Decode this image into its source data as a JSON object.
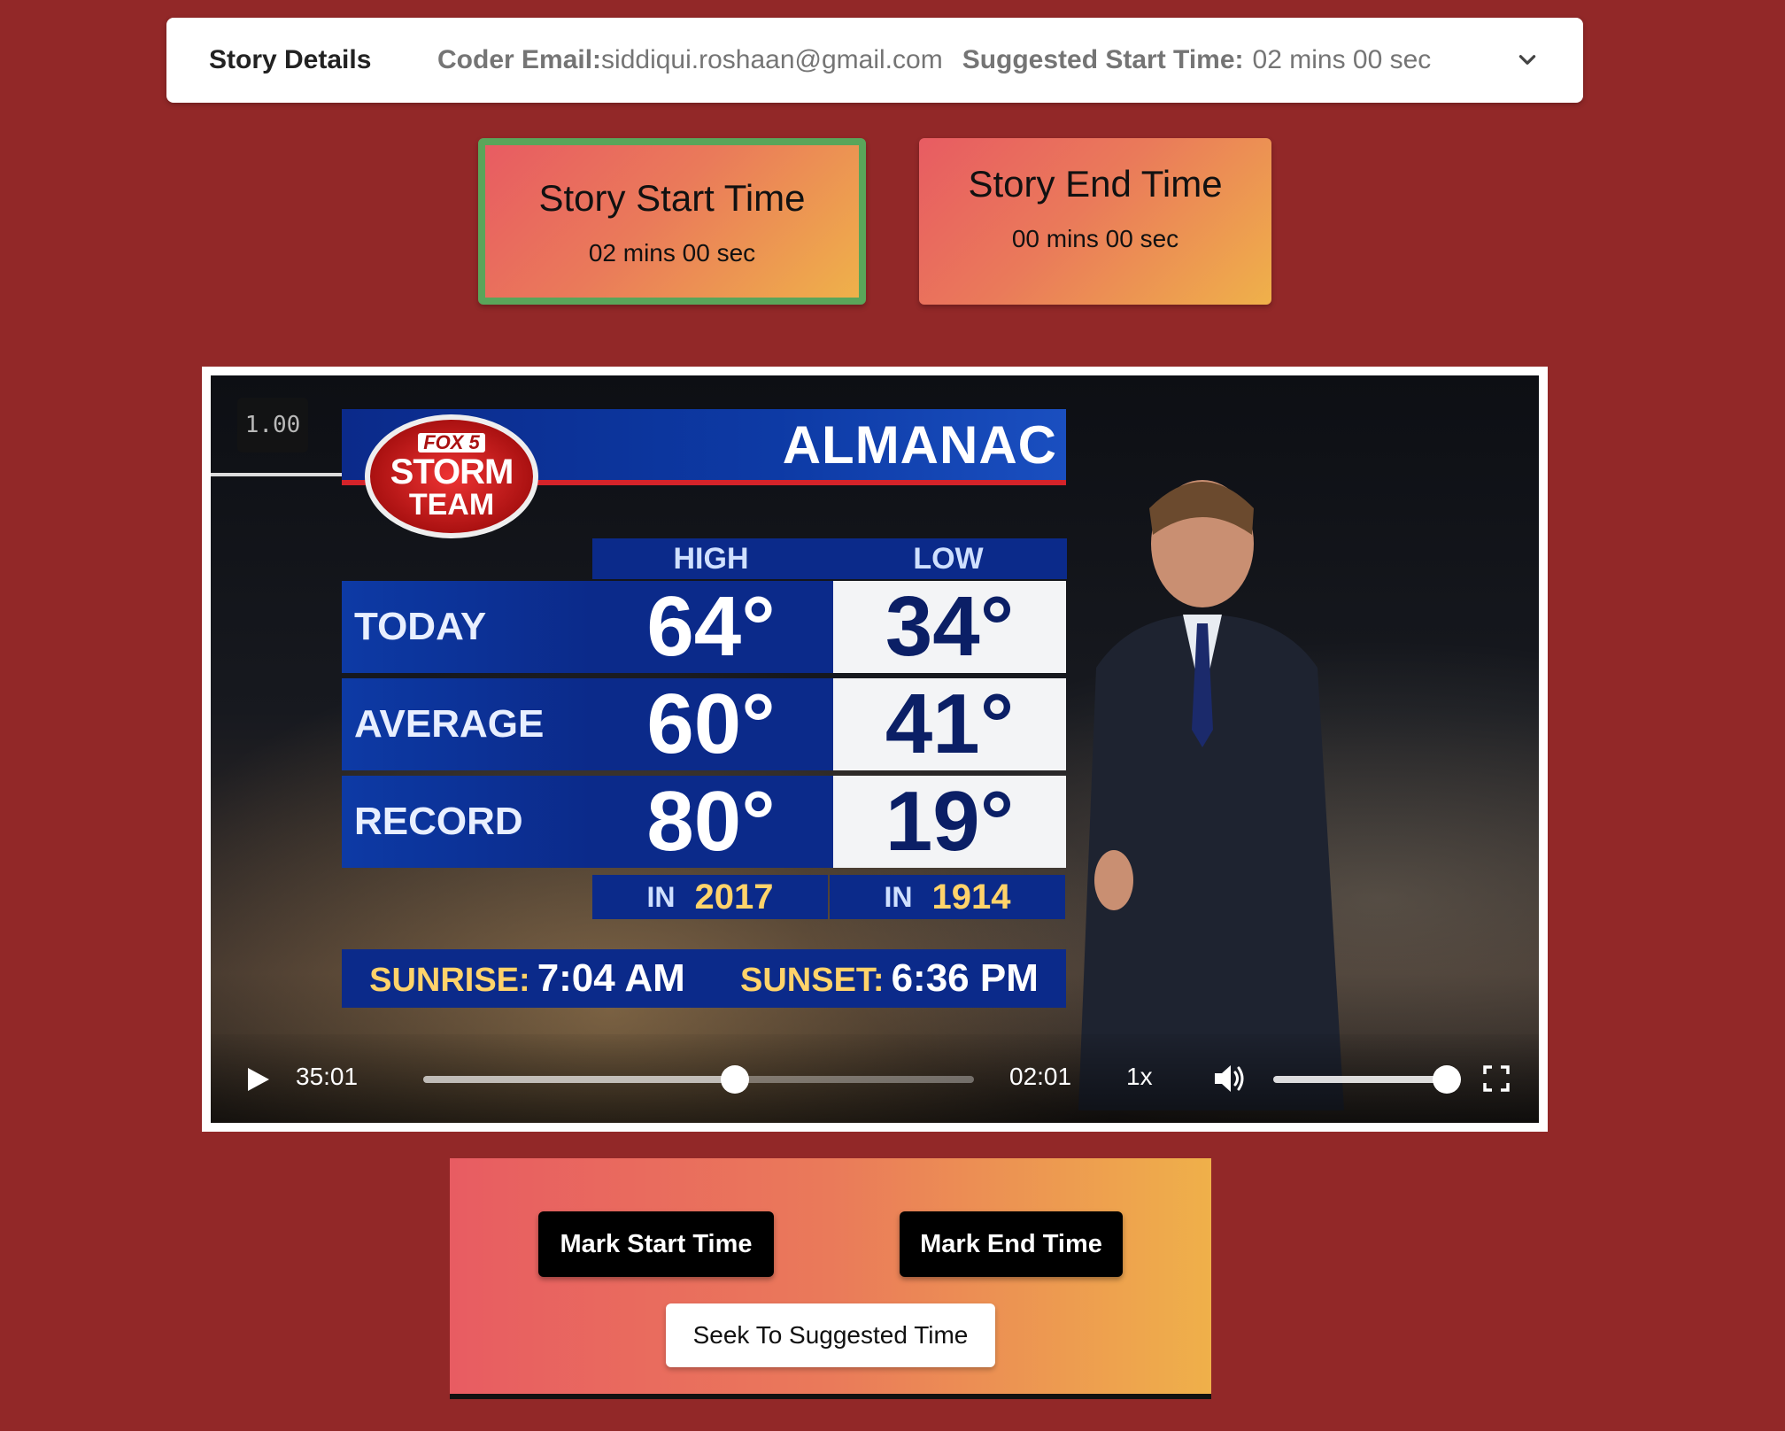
{
  "details": {
    "title": "Story Details",
    "coder_email_label": "Coder Email:",
    "coder_email": "siddiqui.roshaan@gmail.com",
    "suggested_start_label": "Suggested Start Time:",
    "suggested_start_value": "02 mins 00 sec",
    "expand_icon": "chevron-down-icon"
  },
  "cards": {
    "start": {
      "title": "Story Start Time",
      "time": "02 mins 00 sec",
      "highlight_color": "#5aa55a"
    },
    "end": {
      "title": "Story End Time",
      "time": "00 mins 00 sec"
    }
  },
  "video": {
    "speed_badge": "1.00",
    "frame": {
      "header": "ALMANAC",
      "logo": {
        "brand": "FOX 5",
        "line1": "STORM",
        "line2": "TEAM"
      },
      "columns": [
        "HIGH",
        "LOW"
      ],
      "rows": [
        {
          "label": "TODAY",
          "high": "64°",
          "low": "34°"
        },
        {
          "label": "AVERAGE",
          "high": "60°",
          "low": "41°"
        },
        {
          "label": "RECORD",
          "high": "80°",
          "low": "19°"
        }
      ],
      "record_years": [
        {
          "in": "IN",
          "year": "2017"
        },
        {
          "in": "IN",
          "year": "1914"
        }
      ],
      "sunrise_label": "SUNRISE:",
      "sunrise": "7:04 AM",
      "sunset_label": "SUNSET:",
      "sunset": "6:36 PM"
    },
    "controls": {
      "duration": "35:01",
      "current_time": "02:01",
      "playback_speed": "1x",
      "progress_fraction": 0.566,
      "volume_fraction": 1.0,
      "icons": [
        "play-icon",
        "volume-icon",
        "fullscreen-icon"
      ]
    }
  },
  "actions": {
    "mark_start": "Mark Start Time",
    "mark_end": "Mark End Time",
    "seek_suggested": "Seek To Suggested Time"
  },
  "colors": {
    "page_background": "#922828",
    "gradient_start": "#e85c62",
    "gradient_end": "#efb14a"
  }
}
